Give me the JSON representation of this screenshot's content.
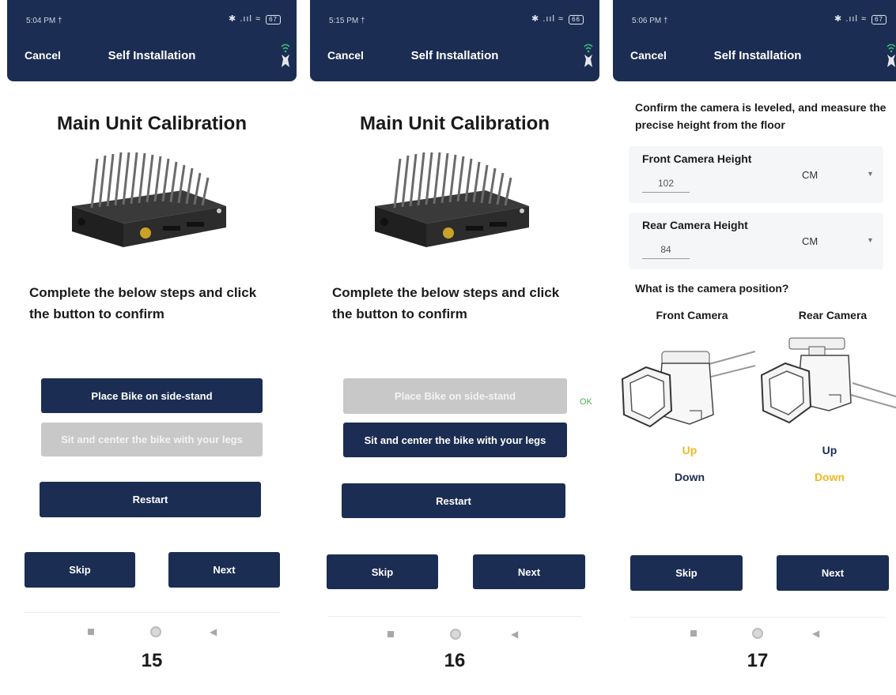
{
  "colors": {
    "navy": "#1b2d52",
    "disabled": "#c8c8c8",
    "ok_green": "#4caf50",
    "selected_yellow": "#f2b824"
  },
  "common": {
    "cancel": "Cancel",
    "title": "Self Installation",
    "main_heading": "Main Unit Calibration",
    "instruction": "Complete the below steps and click the button to confirm",
    "step1": "Place Bike on side-stand",
    "step2": "Sit and center the bike with your legs",
    "restart": "Restart",
    "skip": "Skip",
    "next": "Next",
    "status_icons": "✱ .ııl ≈",
    "nav_icons": [
      "stop-square-icon",
      "home-circle-icon",
      "back-triangle-icon"
    ]
  },
  "screens": [
    {
      "number": "15",
      "time": "5:04 PM †",
      "battery": "67",
      "step1_state": "active",
      "step2_state": "disabled"
    },
    {
      "number": "16",
      "time": "5:15 PM †",
      "battery": "66",
      "step1_state": "disabled",
      "step2_state": "active",
      "step1_result": "OK"
    },
    {
      "number": "17",
      "time": "5:06 PM †",
      "battery": "67",
      "confirm_text": "Confirm the camera is leveled, and measure the precise height from the floor",
      "front_height_label": "Front Camera Height",
      "front_height_value": "102",
      "front_unit": "CM",
      "rear_height_label": "Rear Camera Height",
      "rear_height_value": "84",
      "rear_unit": "CM",
      "position_question": "What is the camera position?",
      "front_camera_label": "Front Camera",
      "rear_camera_label": "Rear Camera",
      "up": "Up",
      "down": "Down",
      "front_selected": "Up",
      "rear_selected": "Down"
    }
  ]
}
